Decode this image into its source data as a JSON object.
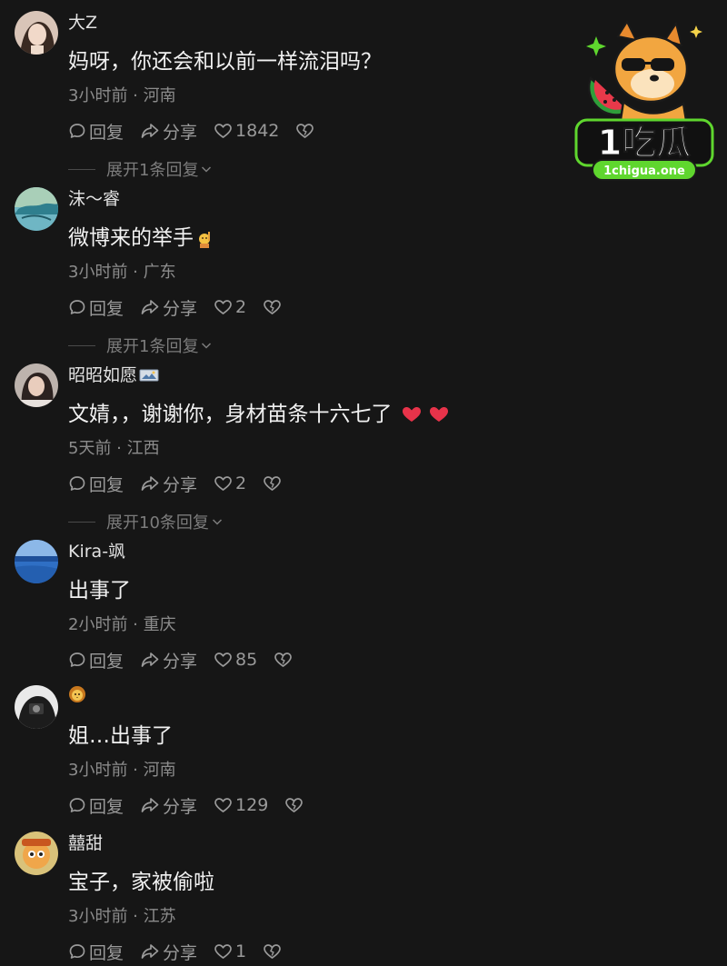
{
  "comments": [
    {
      "username": "大Z",
      "text": "妈呀，你还会和以前一样流泪吗？",
      "meta": "3小时前 · 河南",
      "reply": "回复",
      "share": "分享",
      "likes": "1842",
      "expand": "展开1条回复"
    },
    {
      "username": "沫～睿",
      "text": "微博来的举手",
      "meta": "3小时前 · 广东",
      "reply": "回复",
      "share": "分享",
      "likes": "2",
      "expand": "展开1条回复"
    },
    {
      "username": "昭昭如愿",
      "text": "文婧，，谢谢你，身材苗条十六七了",
      "meta": "5天前 · 江西",
      "reply": "回复",
      "share": "分享",
      "likes": "2",
      "expand": "展开10条回复"
    },
    {
      "username": "Kira-飒",
      "text": "出事了",
      "meta": "2小时前 · 重庆",
      "reply": "回复",
      "share": "分享",
      "likes": "85"
    },
    {
      "username": "",
      "text": "姐…出事了",
      "meta": "3小时前 · 河南",
      "reply": "回复",
      "share": "分享",
      "likes": "129"
    },
    {
      "username": "囍甜",
      "text": "宝子，家被偷啦",
      "meta": "3小时前 · 江苏",
      "reply": "回复",
      "share": "分享",
      "likes": "1"
    }
  ],
  "watermark": {
    "logo_text": "1吃瓜",
    "domain": "1chigua.one"
  },
  "colors": {
    "background": "#161616",
    "text_primary": "#f1f1f1",
    "text_secondary": "#8c8c8c",
    "heart_red": "#e8334a",
    "logo_green": "#5fd62e"
  },
  "icons": [
    "comment-bubble-icon",
    "share-arrow-icon",
    "heart-icon",
    "broken-heart-icon",
    "chevron-down-icon",
    "raised-hand-emoji",
    "photo-badge-icon",
    "red-heart-emoji",
    "lion-face-emoji"
  ]
}
